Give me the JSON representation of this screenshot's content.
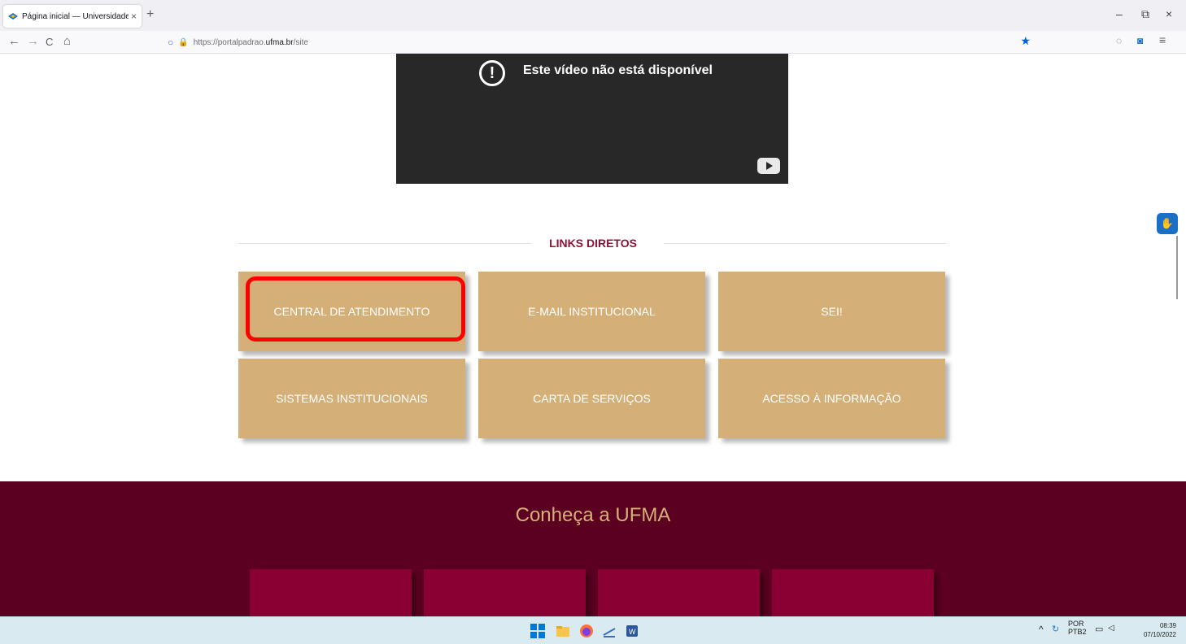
{
  "browser": {
    "tab_title": "Página inicial — Universidade F",
    "url_prefix": "https://portalpadrao.",
    "url_domain": "ufma.br",
    "url_suffix": "/site",
    "new_tab": "+",
    "tab_close": "×",
    "minimize": "–",
    "restore": "⧉",
    "close": "×"
  },
  "nav": {
    "back": "←",
    "forward": "→",
    "reload": "C",
    "home": "⌂",
    "shield": "○",
    "lock": "🔒",
    "star": "★",
    "pocket": "◌",
    "extension": "◙",
    "menu": "≡"
  },
  "video": {
    "message": "Este vídeo não está disponível",
    "warn_glyph": "!"
  },
  "links_section": {
    "title": "LINKS DIRETOS",
    "cards": [
      {
        "label": "CENTRAL DE ATENDIMENTO"
      },
      {
        "label": "E-MAIL INSTITUCIONAL"
      },
      {
        "label": "SEI!"
      },
      {
        "label": "SISTEMAS INSTITUCIONAIS"
      },
      {
        "label": "CARTA DE SERVIÇOS"
      },
      {
        "label": "ACESSO À INFORMAÇÃO"
      }
    ]
  },
  "footer": {
    "title": "Conheça a UFMA"
  },
  "accessibility_widget": "✋",
  "taskbar": {
    "tray_arrow": "^",
    "lang_top": "POR",
    "lang_bottom": "PTB2",
    "time": "08:39",
    "date": "07/10/2022"
  },
  "colors": {
    "card_bg": "#d4b078",
    "section_title": "#8b1538",
    "footer_bg": "#5b0020",
    "footer_box": "#8a0033",
    "highlight": "#ff0000"
  }
}
